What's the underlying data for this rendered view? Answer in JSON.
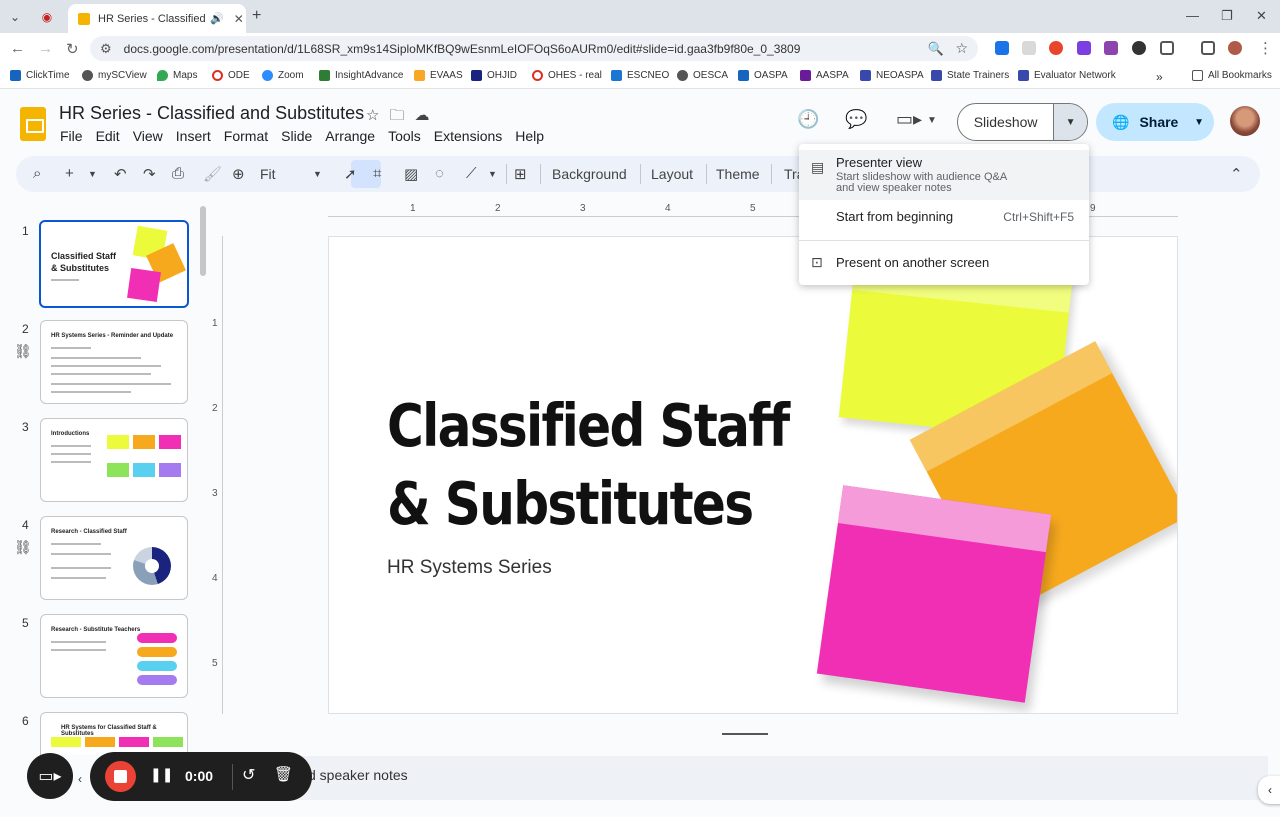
{
  "browser": {
    "tab_title": "HR Series - Classified and Substitutes",
    "url": "docs.google.com/presentation/d/1L68SR_xm9s14SiploMKfBQ9wEsnmLeIOFOqS6oAURm0/edit#slide=id.gaa3fb9f80e_0_3809",
    "bookmarks": [
      "ClickTime",
      "mySCView",
      "Maps",
      "ODE",
      "Zoom",
      "InsightAdvance",
      "EVAAS",
      "OHJID",
      "OHES - real",
      "ESCNEO",
      "OESCA",
      "OASPA",
      "AASPA",
      "NEOASPA",
      "State Trainers",
      "Evaluator Network"
    ],
    "all_bookmarks": "All Bookmarks"
  },
  "doc": {
    "title": "HR Series - Classified and Substitutes",
    "menu": [
      "File",
      "Edit",
      "View",
      "Insert",
      "Format",
      "Slide",
      "Arrange",
      "Tools",
      "Extensions",
      "Help"
    ],
    "slideshow_label": "Slideshow",
    "share_label": "Share"
  },
  "toolbar": {
    "zoom": "Fit",
    "background": "Background",
    "layout": "Layout",
    "theme": "Theme",
    "transition": "Tra"
  },
  "dropdown": {
    "presenter_view": "Presenter view",
    "presenter_desc_1": "Start slideshow with audience Q&A",
    "presenter_desc_2": "and view speaker notes",
    "start_beginning": "Start from beginning",
    "start_shortcut": "Ctrl+Shift+F5",
    "another_screen": "Present on another screen"
  },
  "filmstrip": {
    "numbers": [
      "1",
      "2",
      "3",
      "4",
      "5",
      "6"
    ],
    "thumb_titles": [
      "Classified Staff & Substitutes",
      "HR Systems Series - Reminder and Update",
      "Introductions",
      "Research - Classified Staff",
      "Research - Substitute Teachers",
      "HR Systems for Classified Staff & Substitutes"
    ]
  },
  "ruler": {
    "top": [
      "1",
      "2",
      "3",
      "4",
      "5",
      "9"
    ],
    "left": [
      "1",
      "2",
      "3",
      "4",
      "5"
    ]
  },
  "slide": {
    "title_line1": "Classified Staff",
    "title_line2": "& Substitutes",
    "subtitle": "HR Systems Series"
  },
  "notes": {
    "placeholder": "d speaker notes"
  },
  "recorder": {
    "time": "0:00"
  },
  "colors": {
    "accent": "#0b57d0",
    "share_bg": "#c2e7ff",
    "record": "#ea4335",
    "note_yellow": "#ebfb3c",
    "note_orange": "#f7a91e",
    "note_pink": "#f02fb5"
  }
}
